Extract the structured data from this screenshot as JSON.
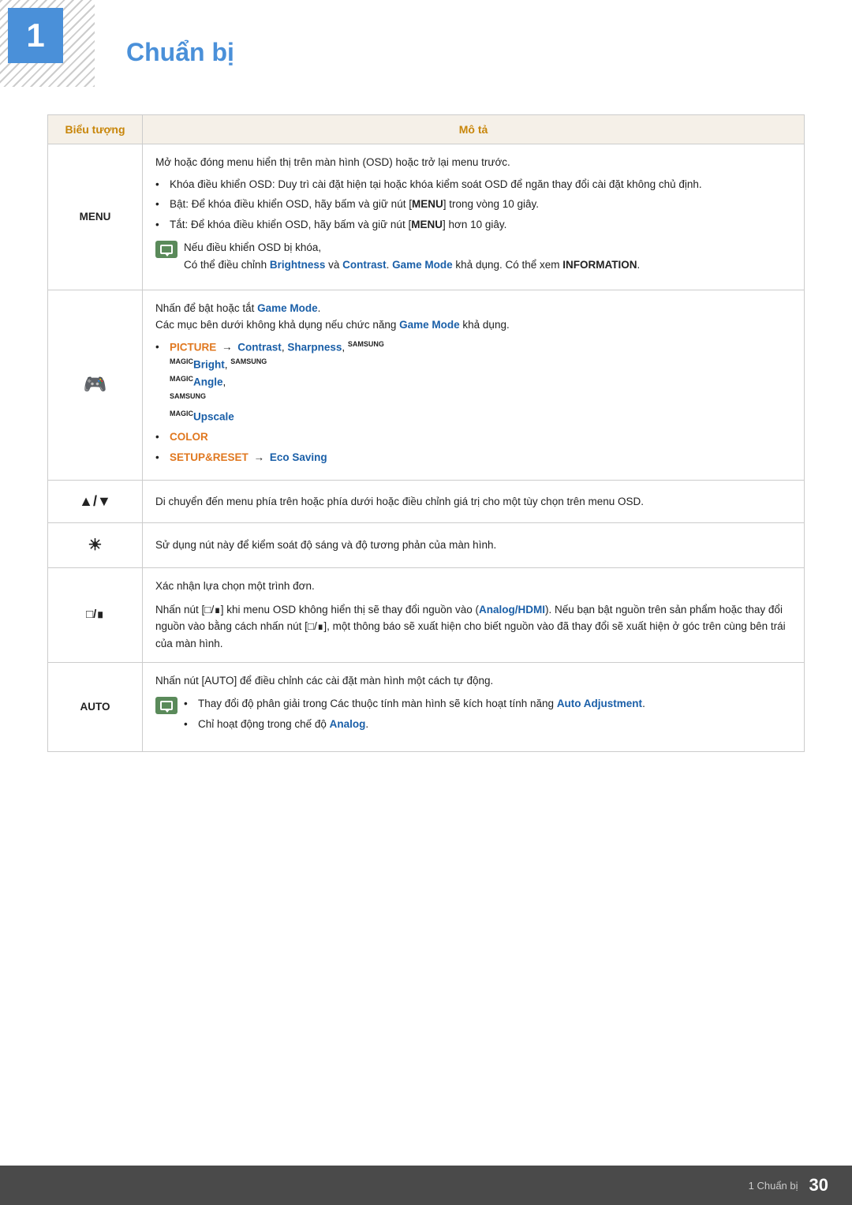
{
  "page": {
    "chapter_number": "1",
    "chapter_title": "Chuẩn bị",
    "footer_chapter": "1 Chuẩn bị",
    "footer_page": "30"
  },
  "table": {
    "col_symbol": "Biểu tượng",
    "col_desc": "Mô tả",
    "rows": [
      {
        "symbol": "MENU",
        "desc_intro": "Mở hoặc đóng menu hiển thị trên màn hình (OSD) hoặc trở lại menu trước.",
        "bullets": [
          "Khóa điều khiển OSD: Duy trì cài đặt hiện tại hoặc khóa kiểm soát OSD để ngăn thay đổi cài đặt không chủ định.",
          "Bật: Để khóa điều khiển OSD, hãy bấm và giữ nút [MENU] trong vòng 10 giây.",
          "Tắt: Để khóa điều khiển OSD, hãy bấm và giữ nút [MENU] hơn 10 giây."
        ],
        "note_text": "Nếu điều khiển OSD bị khóa,",
        "note_extra": "Có thể điều chỉnh Brightness và Contrast. Game Mode khả dụng. Có thể xem INFORMATION."
      },
      {
        "symbol": "gamepad",
        "desc_intro": "Nhấn để bật hoặc tắt Game Mode.",
        "desc2": "Các mục bên dưới không khả dụng nếu chức năng Game Mode khả dụng.",
        "bullets2": [
          "PICTURE → Contrast, Sharpness, SAMSUNGBright, SAMSUNGAngle, SAMSUNGUpscale",
          "COLOR",
          "SETUP&RESET → Eco Saving"
        ]
      },
      {
        "symbol": "▲/▼",
        "desc": "Di chuyển đến menu phía trên hoặc phía dưới hoặc điều chỉnh giá trị cho một tùy chọn trên menu OSD."
      },
      {
        "symbol": "☼",
        "desc": "Sử dụng nút này để kiểm soát độ sáng và độ tương phản của màn hình."
      },
      {
        "symbol": "□/⊟",
        "desc_intro": "Xác nhận lựa chọn một trình đơn.",
        "desc2": "Nhấn nút [□/⊟] khi menu OSD không hiển thị sẽ thay đổi nguồn vào (Analog/HDMI). Nếu bạn bật nguồn trên sản phẩm hoặc thay đổi nguồn vào bằng cách nhấn nút [□/⊟], một thông báo sẽ xuất hiện cho biết nguồn vào đã thay đổi sẽ xuất hiện ở góc trên cùng bên trái của màn hình."
      },
      {
        "symbol": "AUTO",
        "desc_intro": "Nhấn nút [AUTO] để điều chỉnh các cài đặt màn hình một cách tự động.",
        "bullets3": [
          "Thay đổi độ phân giải trong Các thuộc tính màn hình sẽ kích hoạt tính năng Auto Adjustment.",
          "Chỉ hoạt động trong chế độ Analog."
        ]
      }
    ]
  }
}
